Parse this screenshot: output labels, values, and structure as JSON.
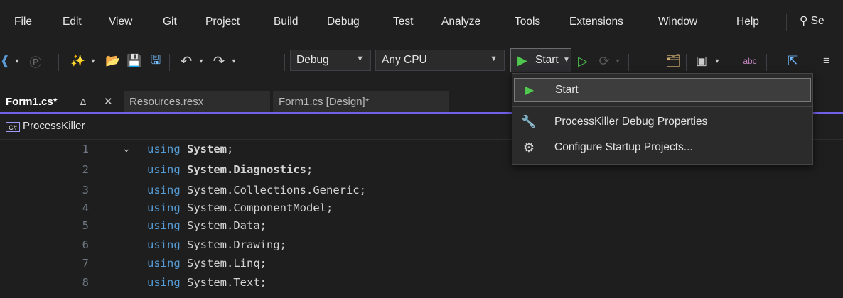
{
  "menubar": {
    "items": [
      "File",
      "Edit",
      "View",
      "Git",
      "Project",
      "Build",
      "Debug",
      "Test",
      "Analyze",
      "Tools",
      "Extensions",
      "Window",
      "Help"
    ],
    "search_label": "Se"
  },
  "toolbar": {
    "config_value": "Debug",
    "platform_value": "Any CPU",
    "start_label": "Start"
  },
  "tabs": [
    {
      "label": "Form1.cs*",
      "active": true
    },
    {
      "label": "Resources.resx",
      "active": false
    },
    {
      "label": "Form1.cs [Design]*",
      "active": false
    }
  ],
  "navbar": {
    "project_badge": "C#",
    "project_name": "ProcessKiller"
  },
  "start_menu": {
    "items": [
      {
        "label": "Start",
        "icon": "play-icon"
      },
      {
        "label": "ProcessKiller Debug Properties",
        "icon": "wrench-icon"
      },
      {
        "label": "Configure Startup Projects...",
        "icon": "gear-icon"
      }
    ]
  },
  "editor": {
    "lines": [
      {
        "num": "1",
        "keyword": "using",
        "ns": "System"
      },
      {
        "num": "2",
        "keyword": "using",
        "ns": "System.Diagnostics"
      },
      {
        "num": "3",
        "keyword": "using",
        "ns": "System.Collections.Generic"
      },
      {
        "num": "4",
        "keyword": "using",
        "ns": "System.ComponentModel"
      },
      {
        "num": "5",
        "keyword": "using",
        "ns": "System.Data"
      },
      {
        "num": "6",
        "keyword": "using",
        "ns": "System.Drawing"
      },
      {
        "num": "7",
        "keyword": "using",
        "ns": "System.Linq"
      },
      {
        "num": "8",
        "keyword": "using",
        "ns": "System.Text"
      }
    ]
  },
  "colors": {
    "accent": "#7160e8",
    "play_green": "#4ec94e",
    "keyword": "#569cd6"
  }
}
